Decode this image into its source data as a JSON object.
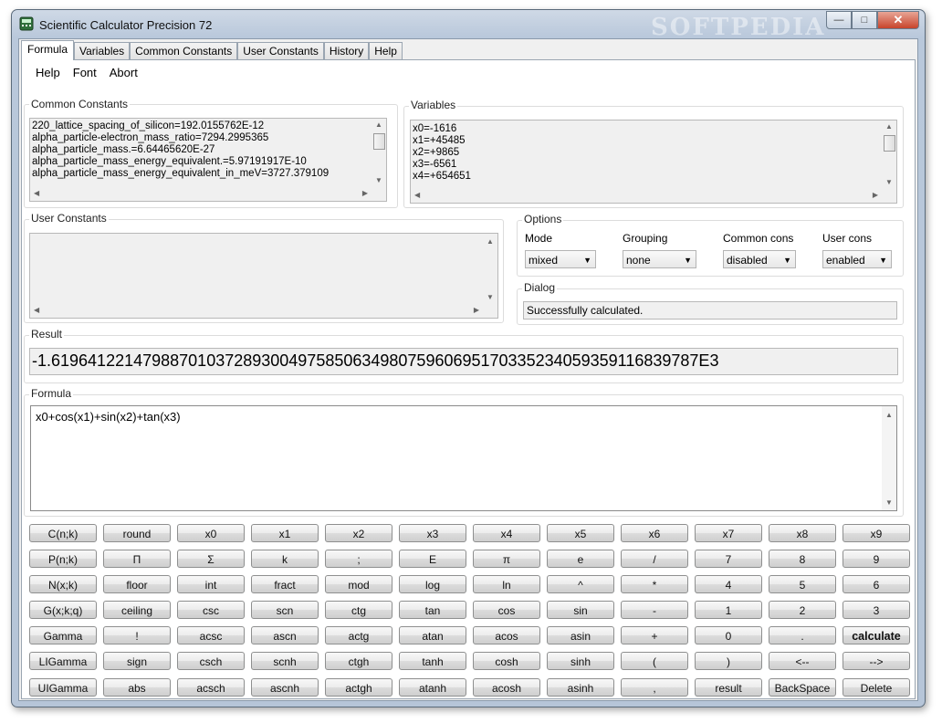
{
  "window": {
    "title": "Scientific Calculator Precision 72",
    "watermark": "SOFTPEDIA"
  },
  "tabs": [
    "Formula",
    "Variables",
    "Common Constants",
    "User Constants",
    "History",
    "Help"
  ],
  "menu": [
    "Help",
    "Font",
    "Abort"
  ],
  "common_constants": {
    "label": "Common Constants",
    "items": [
      "220_lattice_spacing_of_silicon=192.0155762E-12",
      "alpha_particle-electron_mass_ratio=7294.2995365",
      "alpha_particle_mass.=6.64465620E-27",
      "alpha_particle_mass_energy_equivalent.=5.97191917E-10",
      "alpha_particle_mass_energy_equivalent_in_meV=3727.379109"
    ]
  },
  "variables": {
    "label": "Variables",
    "items": [
      "x0=-1616",
      "x1=+45485",
      "x2=+9865",
      "x3=-6561",
      "x4=+654651"
    ]
  },
  "user_constants": {
    "label": "User Constants"
  },
  "options": {
    "label": "Options",
    "mode": {
      "label": "Mode",
      "value": "mixed"
    },
    "grouping": {
      "label": "Grouping",
      "value": "none"
    },
    "common_cons": {
      "label": "Common cons",
      "value": "disabled"
    },
    "user_cons": {
      "label": "User cons",
      "value": "enabled"
    }
  },
  "dialog": {
    "label": "Dialog",
    "message": "Successfully calculated."
  },
  "result": {
    "label": "Result",
    "value": "-1.61964122147988701037289300497585063498075960695170335234059359116839787E3"
  },
  "formula": {
    "label": "Formula",
    "value": "x0+cos(x1)+sin(x2)+tan(x3)"
  },
  "keypad": [
    [
      "C(n;k)",
      "round",
      "x0",
      "x1",
      "x2",
      "x3",
      "x4",
      "x5",
      "x6",
      "x7",
      "x8",
      "x9"
    ],
    [
      "P(n;k)",
      "Π",
      "Σ",
      "k",
      ";",
      "E",
      "π",
      "e",
      "/",
      "7",
      "8",
      "9"
    ],
    [
      "N(x;k)",
      "floor",
      "int",
      "fract",
      "mod",
      "log",
      "ln",
      "^",
      "*",
      "4",
      "5",
      "6"
    ],
    [
      "G(x;k;q)",
      "ceiling",
      "csc",
      "scn",
      "ctg",
      "tan",
      "cos",
      "sin",
      "-",
      "1",
      "2",
      "3"
    ],
    [
      "Gamma",
      "!",
      "acsc",
      "ascn",
      "actg",
      "atan",
      "acos",
      "asin",
      "+",
      "0",
      ".",
      "calculate"
    ],
    [
      "LIGamma",
      "sign",
      "csch",
      "scnh",
      "ctgh",
      "tanh",
      "cosh",
      "sinh",
      "(",
      ")",
      "<--",
      "-->"
    ],
    [
      "UIGamma",
      "abs",
      "acsch",
      "ascnh",
      "actgh",
      "atanh",
      "acosh",
      "asinh",
      ",",
      "result",
      "BackSpace",
      "Delete"
    ]
  ]
}
